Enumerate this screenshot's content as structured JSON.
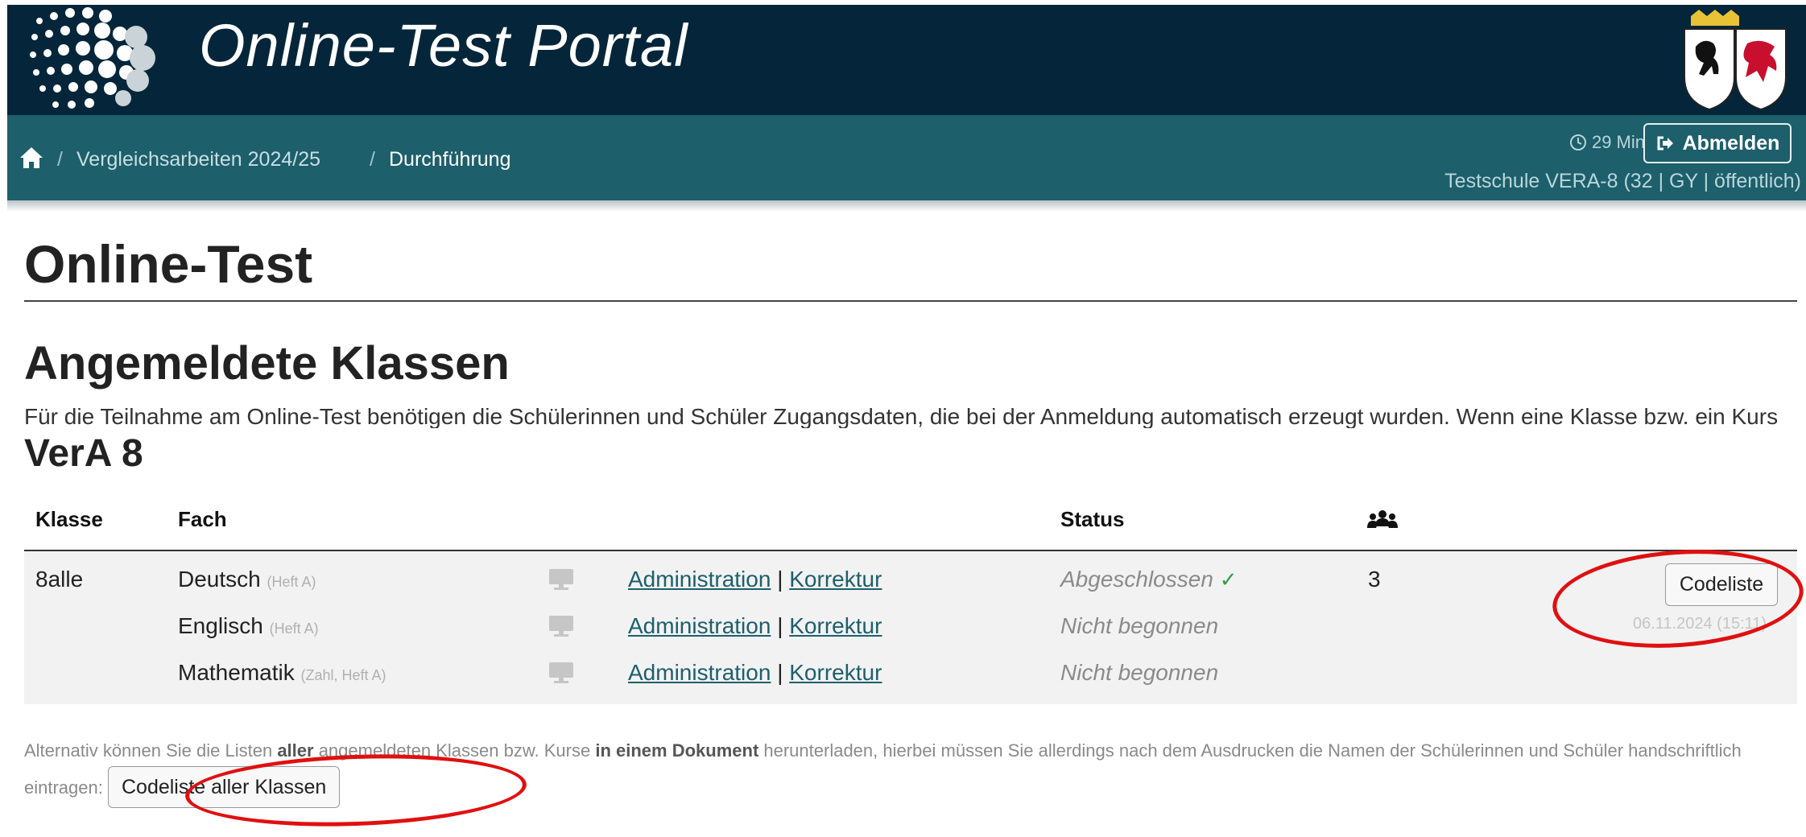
{
  "header": {
    "title": "Online-Test Portal",
    "logo_icon": "dots-sphere-logo",
    "coat_icon": "state-coat-of-arms"
  },
  "nav": {
    "home_icon": "home-icon",
    "separator": "/",
    "breadcrumbs": [
      "Vergleichsarbeiten 2024/25",
      "Durchführung"
    ],
    "timer": "29 Min",
    "logout_label": "Abmelden",
    "school": "Testschule VERA-8 (32 | GY | öffentlich)"
  },
  "page": {
    "title": "Online-Test",
    "section_title": "Angemeldete Klassen",
    "intro": "Für die Teilnahme am Online-Test benötigen die Schülerinnen und Schüler Zugangsdaten, die bei der Anmeldung automatisch erzeugt wurden. Wenn eine Klasse bzw. ein Kurs"
  },
  "vera": {
    "title": "VerA 8",
    "headers": {
      "klasse": "Klasse",
      "fach": "Fach",
      "status": "Status",
      "people_icon": "people-icon"
    },
    "klasse": "8alle",
    "count": "3",
    "codeliste_label": "Codeliste",
    "date": "06.11.2024 (15:11)",
    "link_admin": "Administration",
    "link_sep": "|",
    "link_korrektur": "Korrektur",
    "rows": [
      {
        "fach": "Deutsch",
        "detail": "(Heft A)",
        "status": "Abgeschlossen",
        "check": "✓"
      },
      {
        "fach": "Englisch",
        "detail": "(Heft A)",
        "status": "Nicht begonnen",
        "check": ""
      },
      {
        "fach": "Mathematik",
        "detail": "(Zahl, Heft A)",
        "status": "Nicht begonnen",
        "check": ""
      }
    ]
  },
  "note": {
    "part1": "Alternativ können Sie die Listen ",
    "bold1": "aller",
    "part2": " angemeldeten Klassen bzw. Kurse ",
    "bold2": "in einem Dokument",
    "part3": " herunterladen, hierbei müssen Sie allerdings nach dem Ausdrucken die Namen der Schülerinnen und Schüler handschriftlich eintragen:",
    "button_label": "Codeliste aller Klassen"
  },
  "colors": {
    "header_dark": "#05263a",
    "nav_teal": "#1d5f6b",
    "annotation_red": "#e01010",
    "check_green": "#2e9e44"
  }
}
